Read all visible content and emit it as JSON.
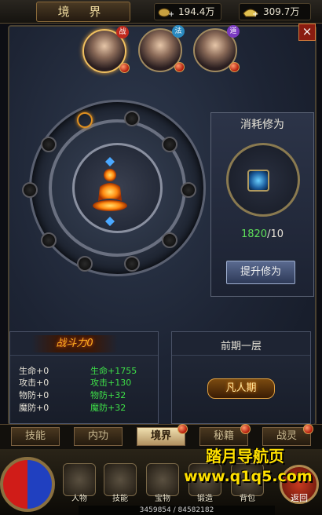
{
  "header": {
    "title": "境 界",
    "gold": "194.4万",
    "ingot": "309.7万"
  },
  "characters": [
    {
      "job": "战",
      "job_color": "#c0281c",
      "selected": true
    },
    {
      "job": "法",
      "job_color": "#2a8ac0",
      "selected": false
    },
    {
      "job": "道",
      "job_color": "#7a3ac0",
      "selected": false
    }
  ],
  "close_label": "×",
  "consume": {
    "title": "消耗修为",
    "have": "1820",
    "need": "/10",
    "button": "提升修为"
  },
  "attributes": {
    "power_label": "战斗力0",
    "current": [
      "生命+0",
      "攻击+0",
      "物防+0",
      "魔防+0"
    ],
    "next": [
      "生命+1755",
      "攻击+130",
      "物防+32",
      "魔防+32"
    ]
  },
  "realm": {
    "name": "前期一层",
    "badge": "凡人期"
  },
  "tabs": [
    {
      "label": "技能",
      "dot": false,
      "active": false
    },
    {
      "label": "内功",
      "dot": false,
      "active": false
    },
    {
      "label": "境界",
      "dot": true,
      "active": true
    },
    {
      "label": "秘籍",
      "dot": true,
      "active": false
    },
    {
      "label": "战灵",
      "dot": true,
      "active": false
    }
  ],
  "menu": [
    "人物",
    "技能",
    "宝物",
    "锻造",
    "背包"
  ],
  "exp_text": "3459854 / 84582182",
  "back_label": "返回",
  "watermark": {
    "line1": "踏月导航页",
    "line2": "www.q1q5.com"
  },
  "colors": {
    "highlight_green": "#3ee048",
    "gold_text": "#f0dca0"
  }
}
